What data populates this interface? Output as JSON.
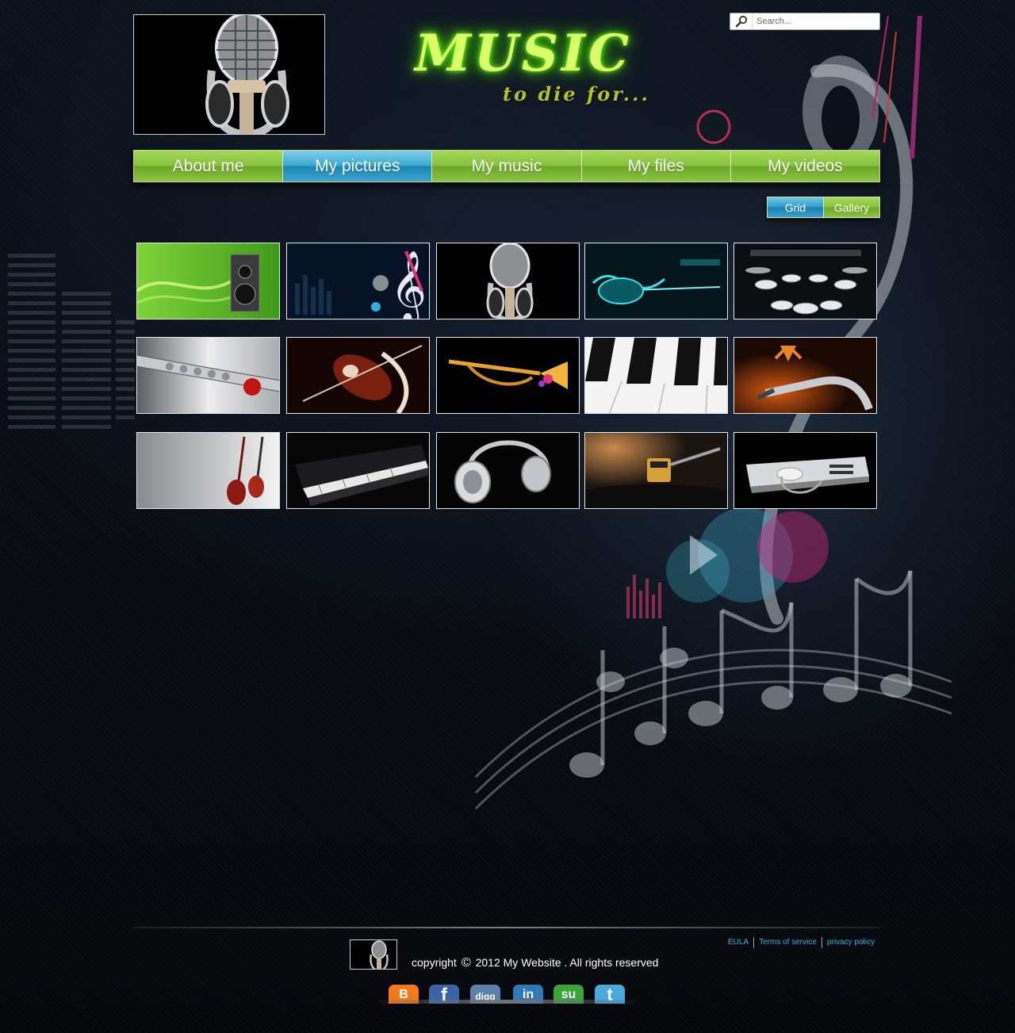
{
  "header": {
    "site_title": "MUSIC",
    "tagline": "to die for...",
    "search_placeholder": "Search..."
  },
  "nav": {
    "items": [
      {
        "label": "About me",
        "active": false
      },
      {
        "label": "My pictures",
        "active": true
      },
      {
        "label": "My music",
        "active": false
      },
      {
        "label": "My files",
        "active": false
      },
      {
        "label": "My videos",
        "active": false
      }
    ]
  },
  "view_toggle": {
    "grid": "Grid",
    "gallery": "Gallery",
    "selected": "Grid"
  },
  "gallery": {
    "thumbnails": [
      "green-speaker",
      "treble-clef-microphone",
      "microphone-headphones",
      "glowing-guitar",
      "drum-kit",
      "flute-rose",
      "violin-art",
      "golden-trumpet",
      "piano-keys-closeup",
      "saxophone-butterfly",
      "guitars-white",
      "grand-piano",
      "headphones-silver",
      "turntable-cartridge",
      "dj-mixer"
    ]
  },
  "footer": {
    "copyright_prefix": "copyright",
    "copyright_symbol": "©",
    "copyright_text": "2012 My Website . All rights reserved",
    "links": [
      "EULA",
      "Terms of service",
      "privacy policy"
    ],
    "social": [
      {
        "name": "blogger-icon",
        "glyph": "B",
        "color": "#f07a1b"
      },
      {
        "name": "facebook-icon",
        "glyph": "f",
        "color": "#3b63a8"
      },
      {
        "name": "digg-icon",
        "glyph": "digg",
        "color": "#5d7fa8"
      },
      {
        "name": "linkedin-icon",
        "glyph": "in",
        "color": "#2f79b5"
      },
      {
        "name": "stumbleupon-icon",
        "glyph": "su",
        "color": "#3aa43a"
      },
      {
        "name": "twitter-icon",
        "glyph": "t",
        "color": "#49a9dc"
      }
    ]
  }
}
